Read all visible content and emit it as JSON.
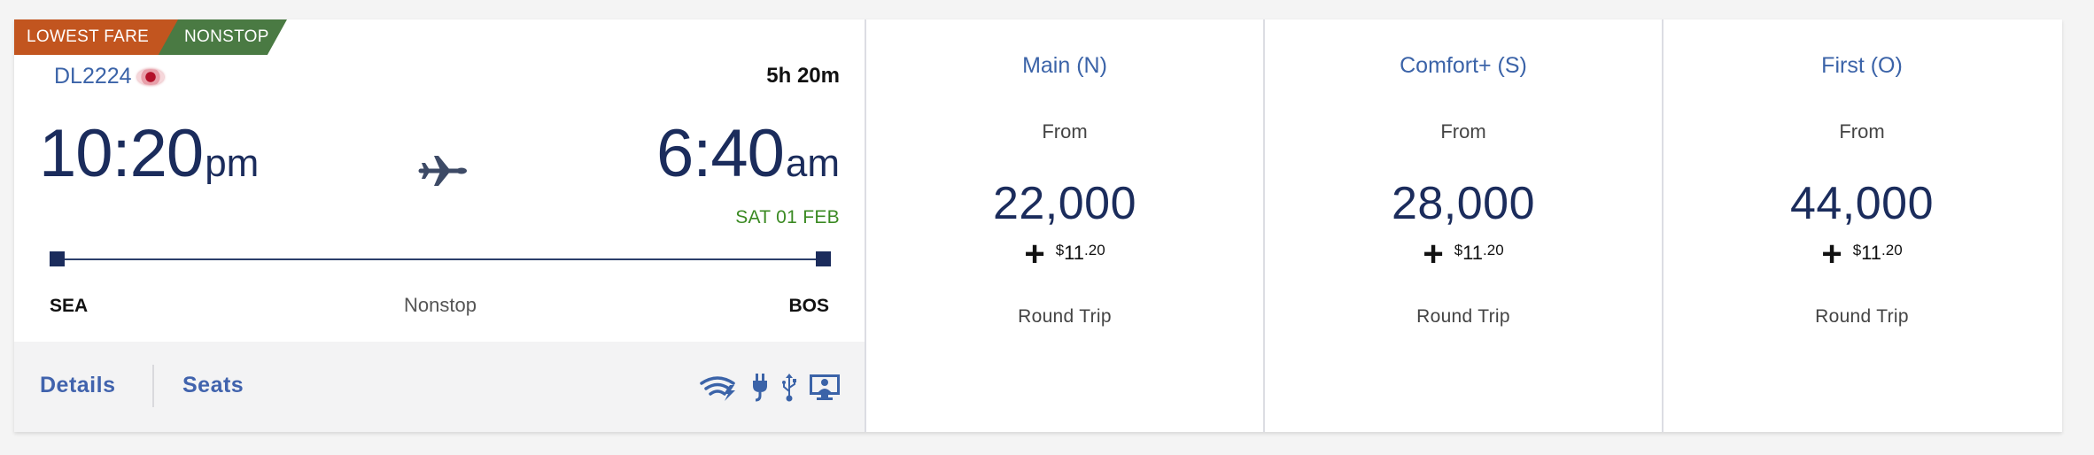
{
  "badges": {
    "lowest": "LOWEST FARE",
    "nonstop": "NONSTOP"
  },
  "flight": {
    "number": "DL2224",
    "duration": "5h 20m",
    "departure": {
      "time": "10:20",
      "ampm": "pm",
      "code": "SEA"
    },
    "arrival": {
      "time": "6:40",
      "ampm": "am",
      "date": "SAT 01 FEB",
      "code": "BOS"
    },
    "stops": "Nonstop"
  },
  "footer": {
    "details": "Details",
    "seats": "Seats",
    "amenities": [
      "wifi-icon",
      "power-icon",
      "usb-icon",
      "seatback-entertainment-icon"
    ]
  },
  "fares": [
    {
      "name": "Main (N)",
      "from": "From",
      "miles": "22,000",
      "tax_symbol": "$",
      "tax_whole": "11",
      "tax_cents": ".20",
      "trip": "Round Trip"
    },
    {
      "name": "Comfort+ (S)",
      "from": "From",
      "miles": "28,000",
      "tax_symbol": "$",
      "tax_whole": "11",
      "tax_cents": ".20",
      "trip": "Round Trip"
    },
    {
      "name": "First (O)",
      "from": "From",
      "miles": "44,000",
      "tax_symbol": "$",
      "tax_whole": "11",
      "tax_cents": ".20",
      "trip": "Round Trip"
    }
  ],
  "colors": {
    "lowest_badge": "#c2551f",
    "nonstop_badge": "#4a7a43",
    "navy": "#1b2c5c",
    "link_blue": "#4163ad",
    "date_green": "#3b8a23"
  }
}
